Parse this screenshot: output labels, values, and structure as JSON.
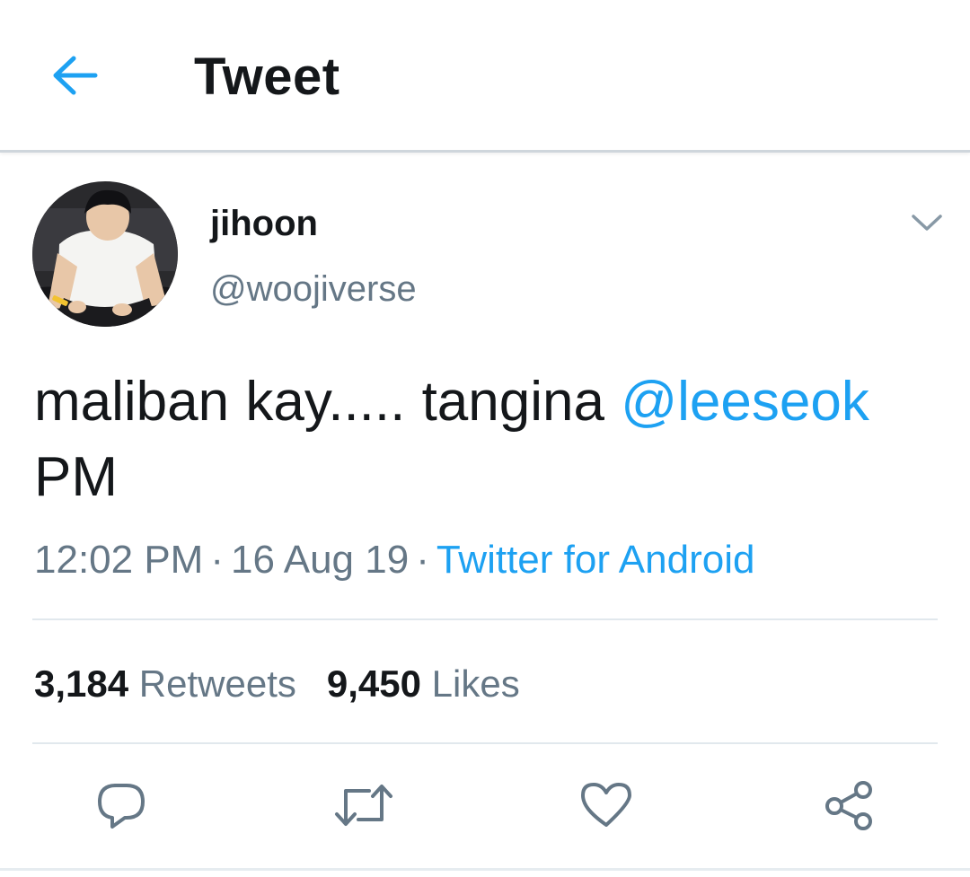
{
  "header": {
    "title": "Tweet",
    "back_icon": "arrow-left-icon"
  },
  "tweet": {
    "author": {
      "display_name": "jihoon",
      "handle": "@woojiverse"
    },
    "text_before_mention": "maliban kay..... tangina ",
    "mention": "@leeseok",
    "text_after_mention": "PM",
    "time": "12:02 PM",
    "date": "16 Aug 19",
    "separator": "·",
    "source": "Twitter for Android"
  },
  "stats": {
    "retweets_count": "3,184",
    "retweets_label": "Retweets",
    "likes_count": "9,450",
    "likes_label": "Likes"
  },
  "actions": [
    {
      "name": "reply",
      "icon": "reply-icon"
    },
    {
      "name": "retweet",
      "icon": "retweet-icon"
    },
    {
      "name": "like",
      "icon": "heart-icon"
    },
    {
      "name": "share",
      "icon": "share-icon"
    }
  ],
  "colors": {
    "accent": "#1da1f2",
    "text_primary": "#14171a",
    "text_secondary": "#657786",
    "divider": "#e1e8ed"
  }
}
